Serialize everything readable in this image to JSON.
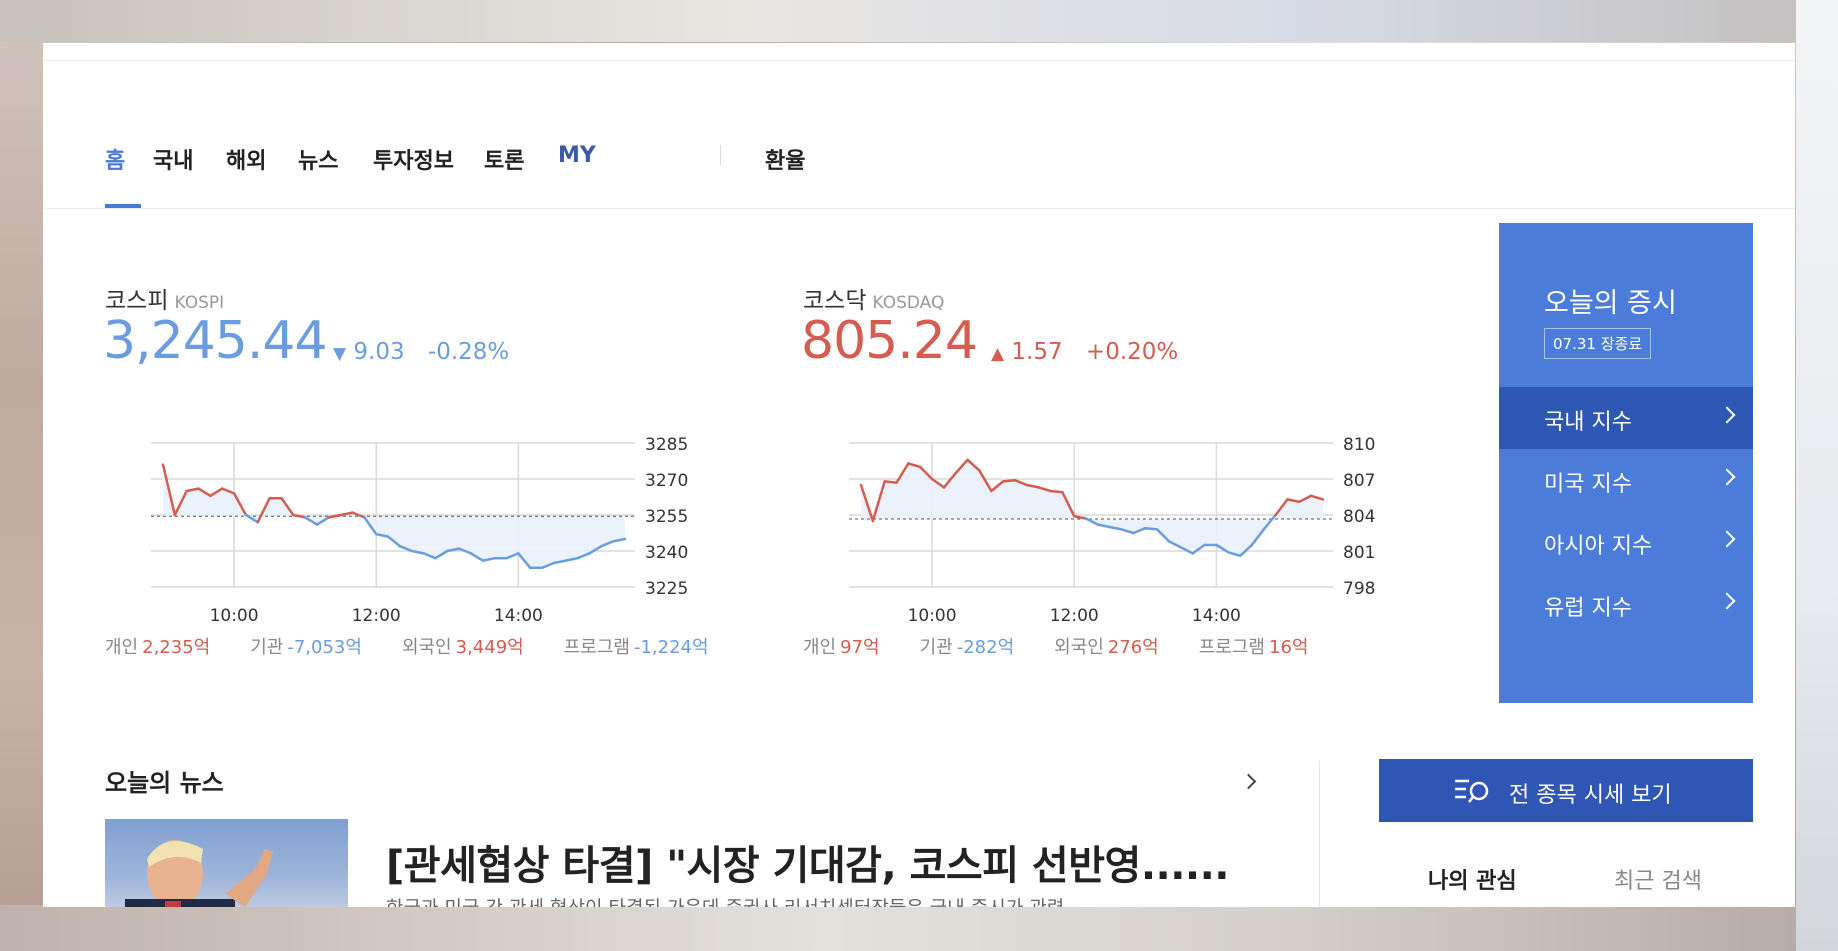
{
  "nav": {
    "items": [
      "홈",
      "국내",
      "해외",
      "뉴스",
      "투자정보",
      "토론",
      "MY"
    ],
    "extra": "환율"
  },
  "kospi": {
    "name": "코스피",
    "code": "KOSPI",
    "value": "3,245.44",
    "change": "9.03",
    "change_pct": "-0.28%",
    "direction": "down",
    "investors": [
      {
        "label": "개인",
        "value": "2,235억",
        "dir": "up"
      },
      {
        "label": "기관",
        "value": "-7,053억",
        "dir": "down"
      },
      {
        "label": "외국인",
        "value": "3,449억",
        "dir": "up"
      },
      {
        "label": "프로그램",
        "value": "-1,224억",
        "dir": "down"
      }
    ]
  },
  "kosdaq": {
    "name": "코스닥",
    "code": "KOSDAQ",
    "value": "805.24",
    "change": "1.57",
    "change_pct": "+0.20%",
    "direction": "up",
    "investors": [
      {
        "label": "개인",
        "value": "97억",
        "dir": "up"
      },
      {
        "label": "기관",
        "value": "-282억",
        "dir": "down"
      },
      {
        "label": "외국인",
        "value": "276억",
        "dir": "up"
      },
      {
        "label": "프로그램",
        "value": "16억",
        "dir": "up"
      }
    ]
  },
  "market_panel": {
    "title": "오늘의 증시",
    "badge": "07.31 장종료",
    "items": [
      "국내 지수",
      "미국 지수",
      "아시아 지수",
      "유럽 지수"
    ]
  },
  "news": {
    "title": "오늘의 뉴스",
    "headline": "[관세협상 타결] \"시장 기대감, 코스피 선반영......",
    "snippet": "한국과 미국 간 관세 협상이 타결된 가운데 증권사 리서치센터장들은 국내 증시가 관련"
  },
  "sidebar": {
    "all_button": "전 종목 시세 보기",
    "tab_fav": "나의 관심",
    "tab_recent": "최근 검색"
  },
  "colors": {
    "up": "#d45c50",
    "down": "#6a9de0",
    "accent": "#4a78d6",
    "panel": "#4c7cd9"
  },
  "chart_data": [
    {
      "type": "line",
      "name": "KOSPI",
      "x": [
        "09:00",
        "09:10",
        "09:20",
        "09:30",
        "09:40",
        "09:50",
        "10:00",
        "10:10",
        "10:20",
        "10:30",
        "10:40",
        "10:50",
        "11:00",
        "11:10",
        "11:20",
        "11:30",
        "11:40",
        "11:50",
        "12:00",
        "12:10",
        "12:20",
        "12:30",
        "12:40",
        "12:50",
        "13:00",
        "13:10",
        "13:20",
        "13:30",
        "13:40",
        "13:50",
        "14:00",
        "14:10",
        "14:20",
        "14:30",
        "14:40",
        "14:50",
        "15:00",
        "15:10",
        "15:20",
        "15:30"
      ],
      "values": [
        3276,
        3255,
        3265,
        3266,
        3263,
        3266,
        3264,
        3255,
        3252,
        3262,
        3262,
        3255,
        3254,
        3251,
        3254,
        3255,
        3256,
        3254,
        3247,
        3246,
        3242,
        3240,
        3239,
        3237,
        3240,
        3241,
        3239,
        3236,
        3237,
        3237,
        3239,
        3233,
        3233,
        3235,
        3236,
        3237,
        3239,
        3242,
        3244,
        3245
      ],
      "prev_close": 3254.47,
      "x_ticks": [
        "10:00",
        "12:00",
        "14:00"
      ],
      "y_ticks": [
        3285,
        3270,
        3255,
        3240,
        3225
      ],
      "ylim": [
        3225,
        3285
      ]
    },
    {
      "type": "line",
      "name": "KOSDAQ",
      "x": [
        "09:00",
        "09:10",
        "09:20",
        "09:30",
        "09:40",
        "09:50",
        "10:00",
        "10:10",
        "10:20",
        "10:30",
        "10:40",
        "10:50",
        "11:00",
        "11:10",
        "11:20",
        "11:30",
        "11:40",
        "11:50",
        "12:00",
        "12:10",
        "12:20",
        "12:30",
        "12:40",
        "12:50",
        "13:00",
        "13:10",
        "13:20",
        "13:30",
        "13:40",
        "13:50",
        "14:00",
        "14:10",
        "14:20",
        "14:30",
        "14:40",
        "14:50",
        "15:00",
        "15:10",
        "15:20",
        "15:30"
      ],
      "values": [
        806.5,
        803.5,
        806.8,
        806.7,
        808.3,
        808.0,
        807.0,
        806.3,
        807.5,
        808.6,
        807.7,
        806.0,
        806.8,
        806.9,
        806.5,
        806.3,
        806.0,
        805.9,
        803.9,
        803.7,
        803.2,
        803.0,
        802.8,
        802.5,
        802.9,
        802.8,
        801.8,
        801.3,
        800.8,
        801.5,
        801.5,
        800.9,
        800.6,
        801.5,
        802.8,
        804.0,
        805.3,
        805.1,
        805.6,
        805.3
      ],
      "prev_close": 803.67,
      "x_ticks": [
        "10:00",
        "12:00",
        "14:00"
      ],
      "y_ticks": [
        810,
        807,
        804,
        801,
        798
      ],
      "ylim": [
        798,
        810
      ]
    }
  ]
}
